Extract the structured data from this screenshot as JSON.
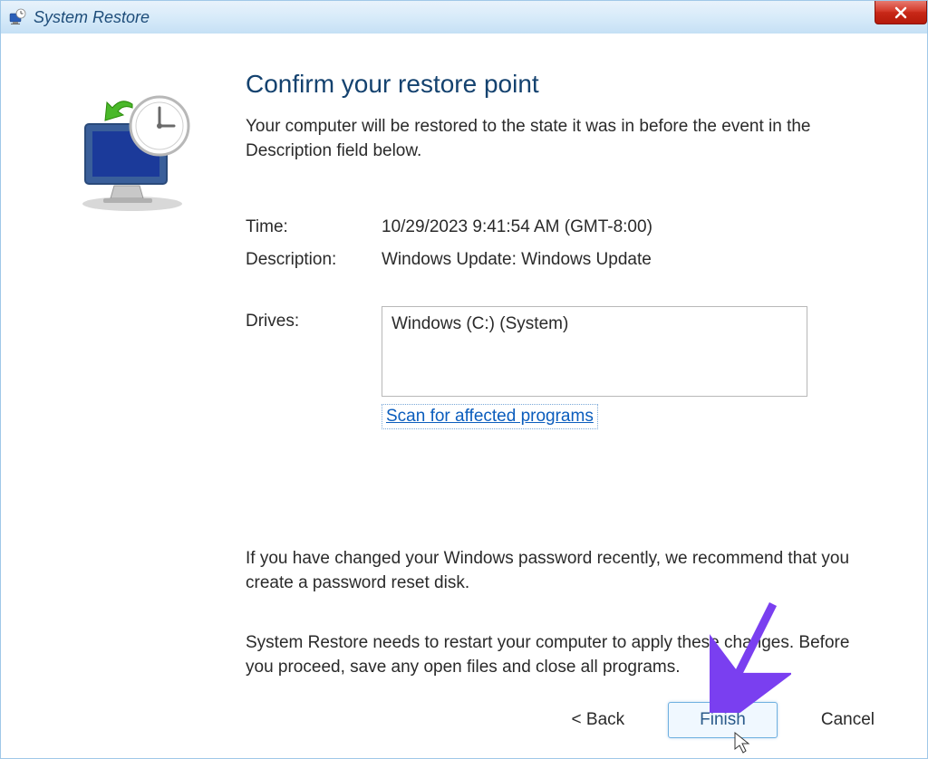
{
  "titlebar": {
    "title": "System Restore"
  },
  "main": {
    "heading": "Confirm your restore point",
    "subheading": "Your computer will be restored to the state it was in before the event in the Description field below.",
    "time_label": "Time:",
    "time_value": "10/29/2023 9:41:54 AM (GMT-8:00)",
    "description_label": "Description:",
    "description_value": "Windows Update: Windows Update",
    "drives_label": "Drives:",
    "drives_value": "Windows (C:) (System)",
    "scan_link": "Scan for affected programs",
    "note_password": "If you have changed your Windows password recently, we recommend that you create a password reset disk.",
    "note_restart": "System Restore needs to restart your computer to apply these changes. Before you proceed, save any open files and close all programs."
  },
  "buttons": {
    "back": "< Back",
    "finish": "Finish",
    "cancel": "Cancel"
  }
}
